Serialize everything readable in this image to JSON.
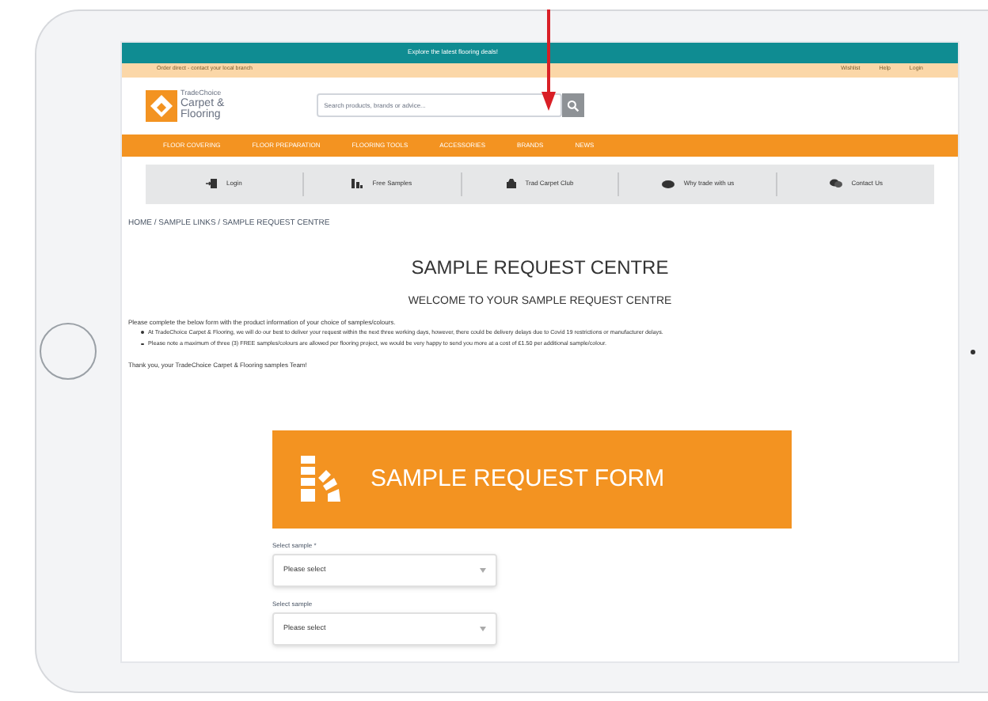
{
  "top_banner": {
    "text": "Explore the latest flooring deals!"
  },
  "info_bar": {
    "text": "Order direct - contact your local branch",
    "links": [
      "Wishlist",
      "Help",
      "Login"
    ]
  },
  "logo": {
    "small": "TradeChoice",
    "line1": "Carpet &",
    "line2": "Flooring"
  },
  "search": {
    "placeholder": "Search products, brands or advice..."
  },
  "nav": [
    "FLOOR COVERING",
    "FLOOR PREPARATION",
    "FLOORING TOOLS",
    "ACCESSORIES",
    "BRANDS",
    "NEWS"
  ],
  "quick_links": [
    {
      "kind": "login",
      "label": "Login"
    },
    {
      "kind": "samples",
      "label": "Free Samples"
    },
    {
      "kind": "club",
      "label": "Trad Carpet Club"
    },
    {
      "kind": "trade",
      "label": "Why trade with us"
    },
    {
      "kind": "contact",
      "label": "Contact Us"
    }
  ],
  "breadcrumb": "HOME / SAMPLE LINKS / SAMPLE REQUEST CENTRE",
  "title": "SAMPLE REQUEST CENTRE",
  "subtitle": "WELCOME TO YOUR SAMPLE REQUEST CENTRE",
  "intro": "Please complete the below form with the product information of your choice of samples/colours.",
  "bullets": [
    "At TradeChoice Carpet & Flooring, we will do our best to deliver your request within the next three working days, however, there could be delivery delays due to Covid 19 restrictions or manufacturer delays.",
    "Please note a maximum of three (3) FREE samples/colours are allowed per flooring project, we would be very happy to send you more at a cost of £1.50 per additional sample/colour."
  ],
  "thanks": "Thank you, your TradeChoice Carpet & Flooring samples Team!",
  "form_banner": "SAMPLE REQUEST FORM",
  "fields": [
    {
      "label": "Select sample *",
      "value": "Please select"
    },
    {
      "label": "Select sample",
      "value": "Please select"
    }
  ]
}
